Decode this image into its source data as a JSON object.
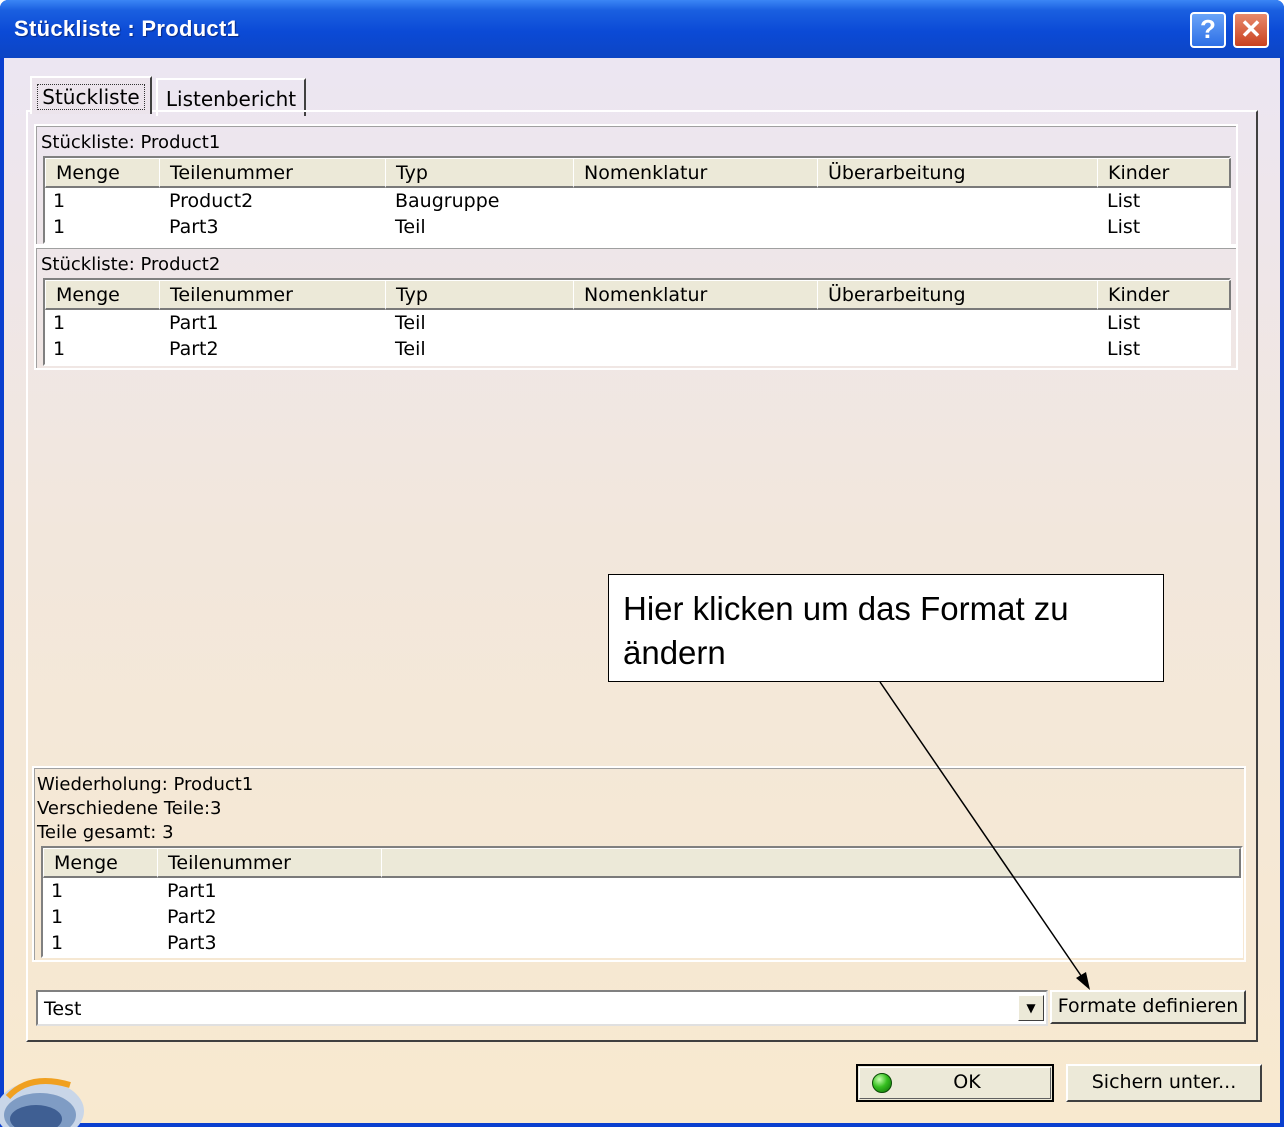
{
  "window": {
    "title": "Stückliste : Product1",
    "help": "?",
    "close": "✕"
  },
  "tabs": [
    {
      "label": "Stückliste"
    },
    {
      "label": "Listenbericht"
    }
  ],
  "bom_sections": [
    {
      "label": "Stückliste: Product1",
      "columns": [
        "Menge",
        "Teilenummer",
        "Typ",
        "Nomenklatur",
        "Überarbeitung",
        "Kinder"
      ],
      "rows": [
        [
          "1",
          "Product2",
          "Baugruppe",
          "",
          "",
          "List"
        ],
        [
          "1",
          "Part3",
          "Teil",
          "",
          "",
          "List"
        ]
      ]
    },
    {
      "label": "Stückliste: Product2",
      "columns": [
        "Menge",
        "Teilenummer",
        "Typ",
        "Nomenklatur",
        "Überarbeitung",
        "Kinder"
      ],
      "rows": [
        [
          "1",
          "Part1",
          "Teil",
          "",
          "",
          "List"
        ],
        [
          "1",
          "Part2",
          "Teil",
          "",
          "",
          "List"
        ]
      ]
    }
  ],
  "summary": {
    "line1": "Wiederholung: Product1",
    "line2": "Verschiedene Teile:3",
    "line3": "Teile gesamt: 3",
    "columns": [
      "Menge",
      "Teilenummer"
    ],
    "rows": [
      [
        "1",
        "Part1"
      ],
      [
        "1",
        "Part2"
      ],
      [
        "1",
        "Part3"
      ]
    ]
  },
  "format_combo": {
    "value": "Test"
  },
  "buttons": {
    "format": "Formate definieren",
    "ok": "OK",
    "save": "Sichern unter..."
  },
  "callout": {
    "text": "Hier klicken um das Format zu ändern"
  }
}
